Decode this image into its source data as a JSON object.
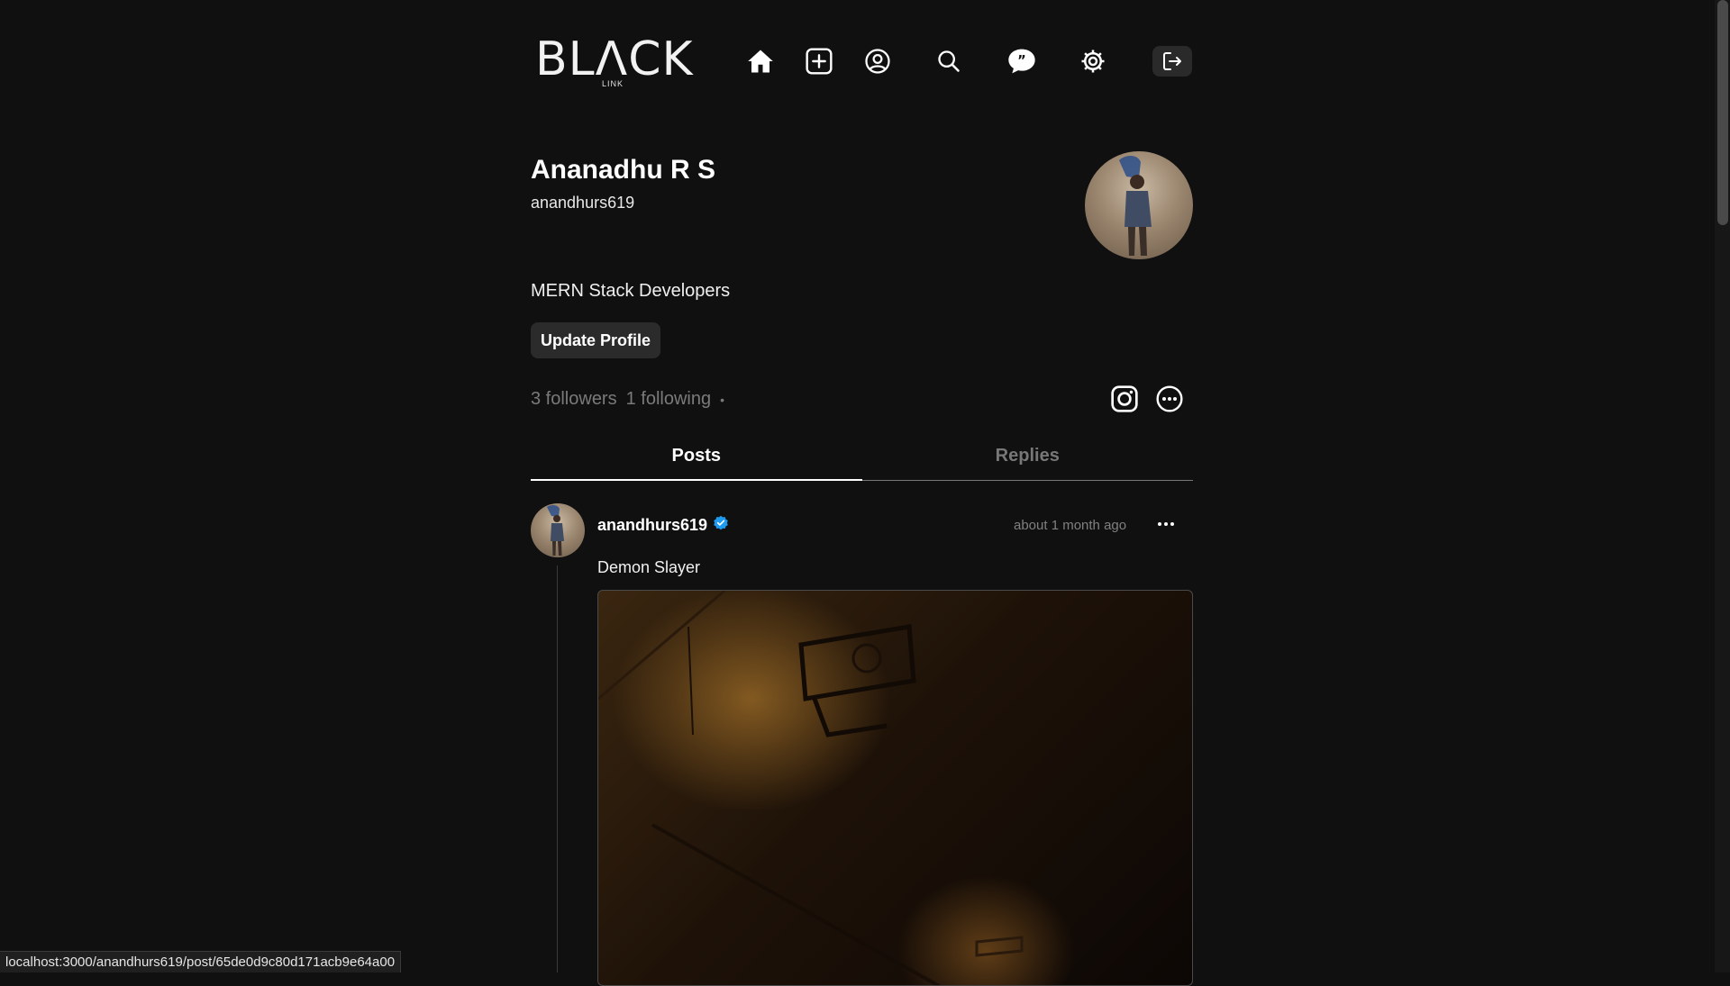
{
  "header": {
    "logo_text": "BLΛCK",
    "logo_sub": "LINK",
    "nav": [
      {
        "icon": "home-icon"
      },
      {
        "icon": "create-post-icon"
      },
      {
        "icon": "profile-icon"
      },
      {
        "icon": "search-icon"
      },
      {
        "icon": "chat-icon"
      },
      {
        "icon": "settings-icon"
      },
      {
        "icon": "logout-icon"
      }
    ]
  },
  "profile": {
    "name": "Ananadhu R S",
    "username": "anandhurs619",
    "bio": "MERN Stack Developers",
    "update_button": "Update Profile",
    "followers": "3 followers",
    "following": "1 following",
    "separator": "•"
  },
  "tabs": [
    {
      "label": "Posts",
      "active": true
    },
    {
      "label": "Replies",
      "active": false
    }
  ],
  "post": {
    "username": "anandhurs619",
    "verified": true,
    "time": "about 1 month ago",
    "text": "Demon Slayer"
  },
  "status_bar": {
    "url": "localhost:3000/anandhurs619/post/65de0d9c80d171acb9e64a00"
  },
  "colors": {
    "background": "#101010",
    "muted_text": "#777777",
    "verified_blue": "#1d9bf0"
  }
}
